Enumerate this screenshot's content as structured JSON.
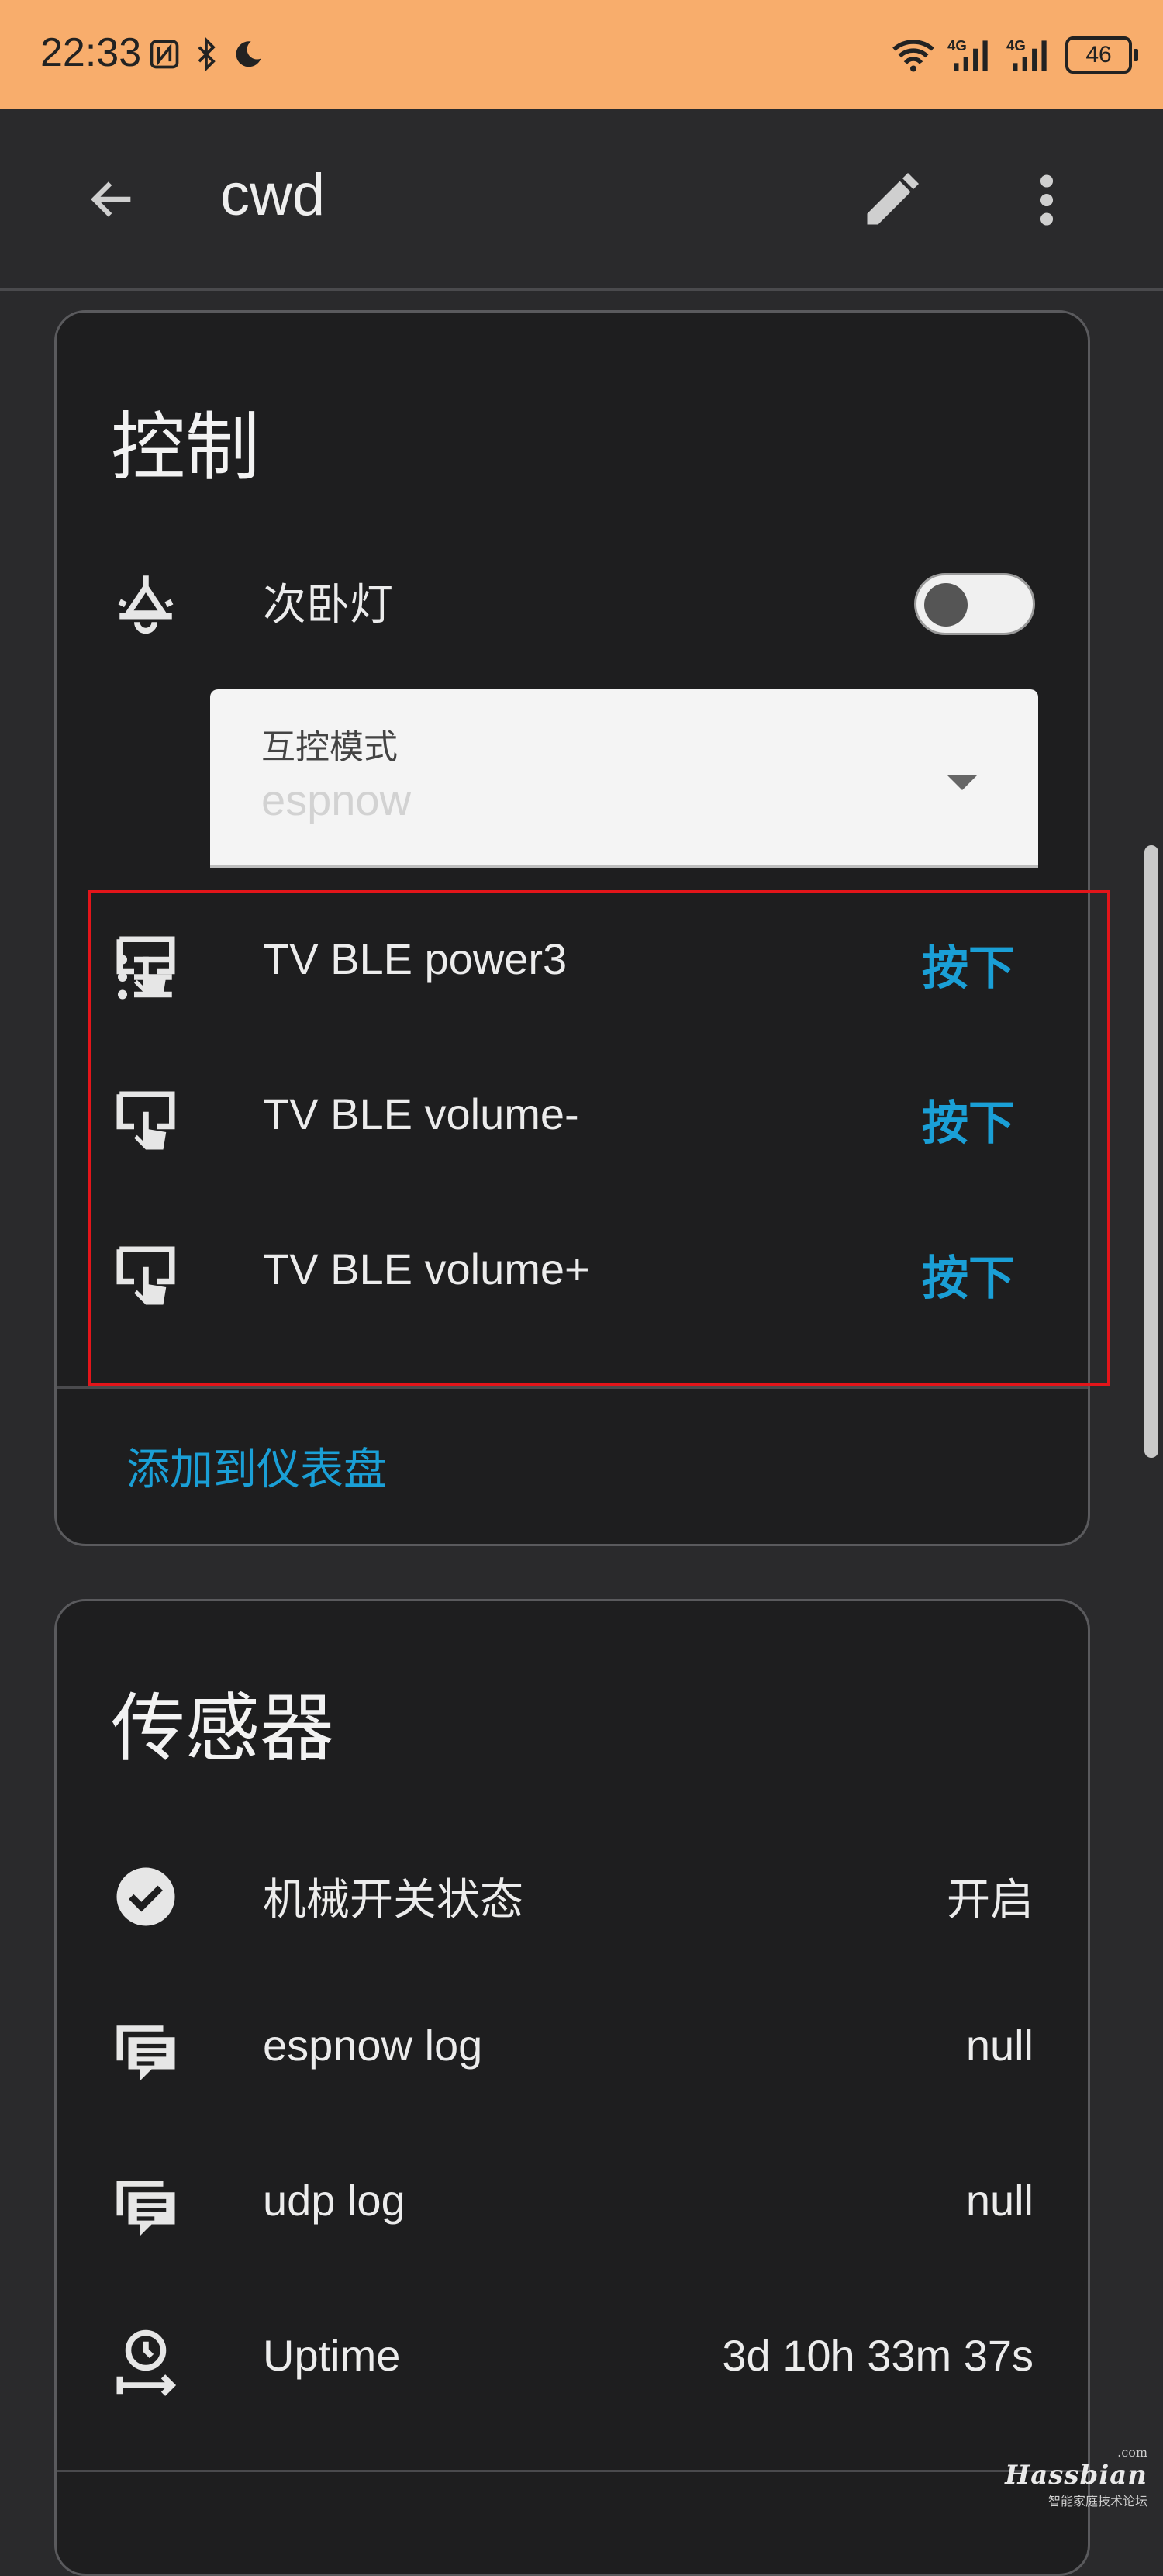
{
  "status_bar": {
    "time": "22:33",
    "icons_left": [
      "nfc-icon",
      "bluetooth-icon",
      "moon-icon"
    ],
    "icons_right": [
      "wifi-icon",
      "signal-4g-icon",
      "signal-4g-icon"
    ],
    "battery": "46"
  },
  "app_bar": {
    "title": "cwd",
    "icons": [
      "back-arrow-icon",
      "edit-pencil-icon",
      "more-vert-icon"
    ]
  },
  "controls_card": {
    "title": "控制",
    "light": {
      "label": "次卧灯",
      "toggle_on": false,
      "icon": "ceiling-light-icon"
    },
    "select": {
      "label": "互控模式",
      "value": "espnow",
      "icon": "list-icon"
    },
    "buttons": [
      {
        "label": "TV BLE power3",
        "action": "按下",
        "icon": "gesture-tap-button-icon"
      },
      {
        "label": "TV BLE volume-",
        "action": "按下",
        "icon": "gesture-tap-button-icon"
      },
      {
        "label": "TV BLE volume+",
        "action": "按下",
        "icon": "gesture-tap-button-icon"
      }
    ],
    "add_to_dashboard": "添加到仪表盘"
  },
  "sensors_card": {
    "title": "传感器",
    "rows": [
      {
        "label": "机械开关状态",
        "value": "开启",
        "icon": "check-circle-icon"
      },
      {
        "label": "espnow log",
        "value": "null",
        "icon": "message-text-icon"
      },
      {
        "label": "udp log",
        "value": "null",
        "icon": "message-text-icon"
      },
      {
        "label": "Uptime",
        "value": "3d 10h 33m 37s",
        "icon": "timer-outline-icon"
      }
    ]
  },
  "watermark": {
    "brand": "Hassbian",
    "sub": ".com",
    "tagline": "智能家庭技术论坛"
  },
  "colors": {
    "status_bar_bg": "#f8ad6c",
    "accent": "#1a9fd6",
    "highlight": "#e3151a",
    "card_bg": "#1e1e1f"
  }
}
